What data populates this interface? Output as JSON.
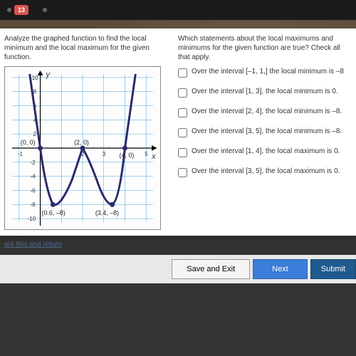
{
  "topbar": {
    "badge": "13"
  },
  "left": {
    "prompt": "Analyze the graphed function to find the local minimum and the local maximum for the given function."
  },
  "right": {
    "question": "Which statements about the local maximums and minimums for the given function are true? Check all that apply.",
    "options": [
      "Over the interval [–1, 1,] the local minimum is –8",
      "Over the interval [1, 3], the local minimum is 0.",
      "Over the interval [2, 4], the local minimum is –8.",
      "Over the interval [3, 5], the local minimum is –8.",
      "Over the interval [1, 4], the local maximum is 0.",
      "Over the interval [3, 5], the local maximum is 0."
    ]
  },
  "links": {
    "mark": "ark this and return"
  },
  "buttons": {
    "save": "Save and Exit",
    "next": "Next",
    "submit": "Submit"
  },
  "graph": {
    "ylabel": "y",
    "xlabel": "x",
    "points": [
      "(0, 0)",
      "(2, 0)",
      "(4, 0)",
      "(0.6, –8)",
      "(3.4, –8)"
    ]
  },
  "chart_data": {
    "type": "line",
    "title": "",
    "xlabel": "x",
    "ylabel": "y",
    "xlim": [
      -1,
      5
    ],
    "ylim": [
      -10,
      10
    ],
    "x": [
      -0.5,
      -0.2,
      0,
      0.3,
      0.6,
      1.0,
      1.5,
      2.0,
      2.5,
      3.0,
      3.4,
      3.7,
      4.0,
      4.2,
      4.5
    ],
    "values": [
      10,
      4,
      0,
      -5,
      -8,
      -6,
      -2.5,
      0,
      -2.5,
      -6,
      -8,
      -5,
      0,
      4,
      10
    ],
    "key_points": [
      {
        "label": "(0, 0)",
        "x": 0,
        "y": 0
      },
      {
        "label": "(2, 0)",
        "x": 2,
        "y": 0
      },
      {
        "label": "(4, 0)",
        "x": 4,
        "y": 0
      },
      {
        "label": "(0.6, –8)",
        "x": 0.6,
        "y": -8
      },
      {
        "label": "(3.4, –8)",
        "x": 3.4,
        "y": -8
      }
    ]
  }
}
